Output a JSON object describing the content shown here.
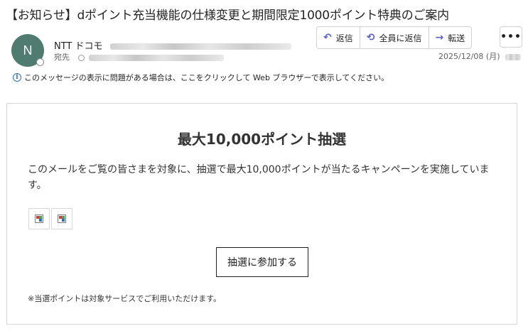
{
  "email": {
    "subject": "【お知らせ】dポイント充当機能の仕様変更と期間限定1000ポイント特典のご案内",
    "avatar_initial": "N",
    "sender_name": "NTT ドコモ",
    "recipient_label": "宛先",
    "date": "2025/12/08 (月)",
    "info_bar": "このメッセージの表示に問題がある場合は、ここをクリックして Web ブラウザーで表示してください。"
  },
  "actions": {
    "reply": "返信",
    "reply_all": "全員に返信",
    "forward": "転送",
    "more": "•••"
  },
  "content": {
    "heading": "最大10,000ポイント抽選",
    "body": "このメールをご覧の皆さまを対象に、抽選で最大10,000ポイントが当たるキャンペーンを実施しています。",
    "cta": "抽選に参加する",
    "note": "※当選ポイントは対象サービスでご利用いただけます。"
  },
  "colors": {
    "accent": "#5b5fc7",
    "avatar_bg": "#4f7b70",
    "info_icon": "#2f6fb5"
  }
}
